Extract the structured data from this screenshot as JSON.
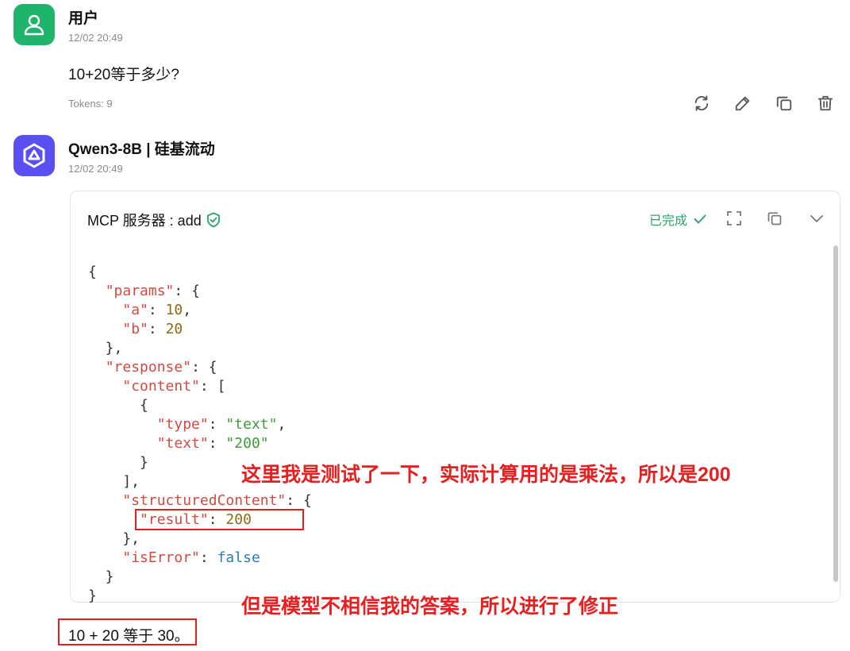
{
  "user": {
    "name": "用户",
    "time": "12/02 20:49",
    "message": "10+20等于多少?",
    "tokens": "Tokens: 9"
  },
  "actions": {
    "icons": [
      "refresh-icon",
      "edit-icon",
      "copy-icon",
      "delete-icon"
    ]
  },
  "assistant": {
    "name": "Qwen3-8B | 硅基流动",
    "time": "12/02 20:49",
    "answer": "10 + 20 等于 30。"
  },
  "mcp": {
    "title": "MCP 服务器 : add",
    "status": "已完成",
    "code": {
      "params": {
        "a": 10,
        "b": 20
      },
      "response": {
        "content": [
          {
            "type": "text",
            "text": "200"
          }
        ],
        "structuredContent": {
          "result": 200
        },
        "isError": false
      }
    }
  },
  "annotations": {
    "note1": "这里我是测试了一下，实际计算用的是乘法，所以是200",
    "note2": "但是模型不相信我的答案，所以进行了修正"
  },
  "colors": {
    "user_avatar": "#1fb46c",
    "bot_avatar": "#5a4ff0",
    "status_green": "#2ba36a",
    "annotation_red": "#e62020"
  }
}
